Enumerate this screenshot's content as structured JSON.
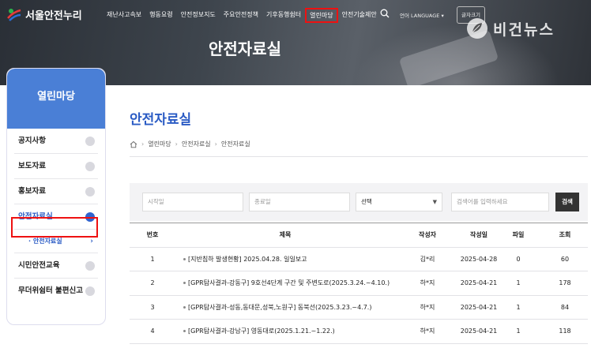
{
  "brand": {
    "logo_text": "서울안전누리",
    "watermark_text": "비건뉴스"
  },
  "nav": {
    "items": [
      "재난사고속보",
      "행동요령",
      "안전정보지도",
      "주요안전정책",
      "기후동행쉼터",
      "열린마당",
      "안전기술제안"
    ],
    "highlighted_index": 5,
    "language_label": "언어 LANGUAGE",
    "font_size_label": "글자크기"
  },
  "hero": {
    "title": "안전자료실"
  },
  "sidebar": {
    "header": "열린마당",
    "items": [
      {
        "label": "공지사항",
        "active": false
      },
      {
        "label": "보도자료",
        "active": false
      },
      {
        "label": "홍보자료",
        "active": false
      },
      {
        "label": "안전자료실",
        "active": true
      },
      {
        "label": "시민안전교육",
        "active": false
      },
      {
        "label": "무더위쉼터 불편신고",
        "active": false
      }
    ],
    "subitem": "안전자료실"
  },
  "content": {
    "title": "안전자료실",
    "breadcrumb": [
      "열린마당",
      "안전자료실",
      "안전자료실"
    ]
  },
  "filter": {
    "start_placeholder": "시작일",
    "end_placeholder": "종료일",
    "select_value": "선택",
    "search_placeholder": "검색어를 입력하세요",
    "search_button": "검색"
  },
  "table": {
    "columns": [
      "번호",
      "제목",
      "작성자",
      "작성일",
      "파일",
      "조회"
    ],
    "rows": [
      {
        "num": "1",
        "title": "[지반침하 발생현황] 2025.04.28. 일일보고",
        "author": "김*리",
        "date": "2025-04-28",
        "file": "0",
        "views": "60"
      },
      {
        "num": "2",
        "title": "[GPR탐사결과-강동구] 9호선4단계 구간 및 주변도로(2025.3.24.~4.10.)",
        "author": "하*지",
        "date": "2025-04-21",
        "file": "1",
        "views": "178"
      },
      {
        "num": "3",
        "title": "[GPR탐사결과-성동,동대문,성북,노원구] 동북선(2025.3.23.~4.7.)",
        "author": "하*지",
        "date": "2025-04-21",
        "file": "1",
        "views": "84"
      },
      {
        "num": "4",
        "title": "[GPR탐사결과-강남구] 영동대로(2025.1.21.~1.22.)",
        "author": "하*지",
        "date": "2025-04-21",
        "file": "1",
        "views": "118"
      }
    ]
  },
  "colors": {
    "accent": "#2a5bc4",
    "sidebar_header": "#4a7fd6",
    "highlight_box": "#ee1111"
  }
}
